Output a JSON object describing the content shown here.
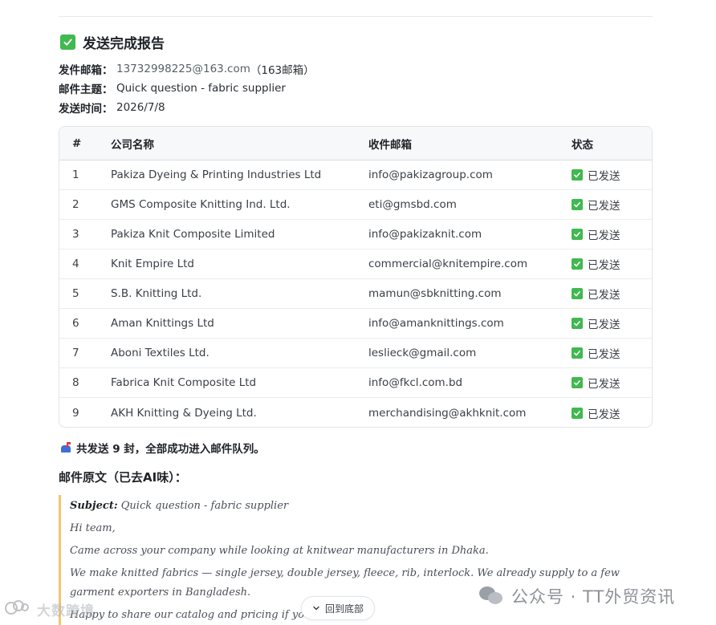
{
  "report": {
    "title": "发送完成报告",
    "sender_label": "发件邮箱：",
    "sender_value": "13732998225@163.com",
    "sender_note": "（163邮箱）",
    "subject_label": "邮件主题：",
    "subject_value": "Quick question - fabric supplier",
    "time_label": "发送时间：",
    "time_value": "2026/7/8"
  },
  "table": {
    "headers": [
      "#",
      "公司名称",
      "收件邮箱",
      "状态"
    ],
    "rows": [
      {
        "num": "1",
        "company": "Pakiza Dyeing & Printing Industries Ltd",
        "email": "info@pakizagroup.com",
        "status": "已发送"
      },
      {
        "num": "2",
        "company": "GMS Composite Knitting Ind. Ltd.",
        "email": "eti@gmsbd.com",
        "status": "已发送"
      },
      {
        "num": "3",
        "company": "Pakiza Knit Composite Limited",
        "email": "info@pakizaknit.com",
        "status": "已发送"
      },
      {
        "num": "4",
        "company": "Knit Empire Ltd",
        "email": "commercial@knitempire.com",
        "status": "已发送"
      },
      {
        "num": "5",
        "company": "S.B. Knitting Ltd.",
        "email": "mamun@sbknitting.com",
        "status": "已发送"
      },
      {
        "num": "6",
        "company": "Aman Knittings Ltd",
        "email": "info@amanknittings.com",
        "status": "已发送"
      },
      {
        "num": "7",
        "company": "Aboni Textiles Ltd.",
        "email": "leslieck@gmail.com",
        "status": "已发送"
      },
      {
        "num": "8",
        "company": "Fabrica Knit Composite Ltd",
        "email": "info@fkcl.com.bd",
        "status": "已发送"
      },
      {
        "num": "9",
        "company": "AKH Knitting & Dyeing Ltd.",
        "email": "merchandising@akhknit.com",
        "status": "已发送"
      }
    ]
  },
  "summary": {
    "text": "共发送 9 封，全部成功进入邮件队列。"
  },
  "original": {
    "heading": "邮件原文（已去AI味）：",
    "subject_label": "Subject:",
    "subject_value": " Quick question - fabric supplier",
    "p1": "Hi team,",
    "p2": "Came across your company while looking at knitwear manufacturers in Dhaka.",
    "p3": "We make knitted fabrics — single jersey, double jersey, fleece, rib, interlock. We already supply to a few garment exporters in Bangladesh.",
    "p4": "Happy to share our catalog and pricing if you're in"
  },
  "ui": {
    "back_to_bottom": "回到底部"
  },
  "watermarks": {
    "left": "大数跨境",
    "right": "公众号 · TT外贸资讯"
  },
  "colors": {
    "check_green": "#3fb950",
    "quote_border": "#f3c572"
  }
}
